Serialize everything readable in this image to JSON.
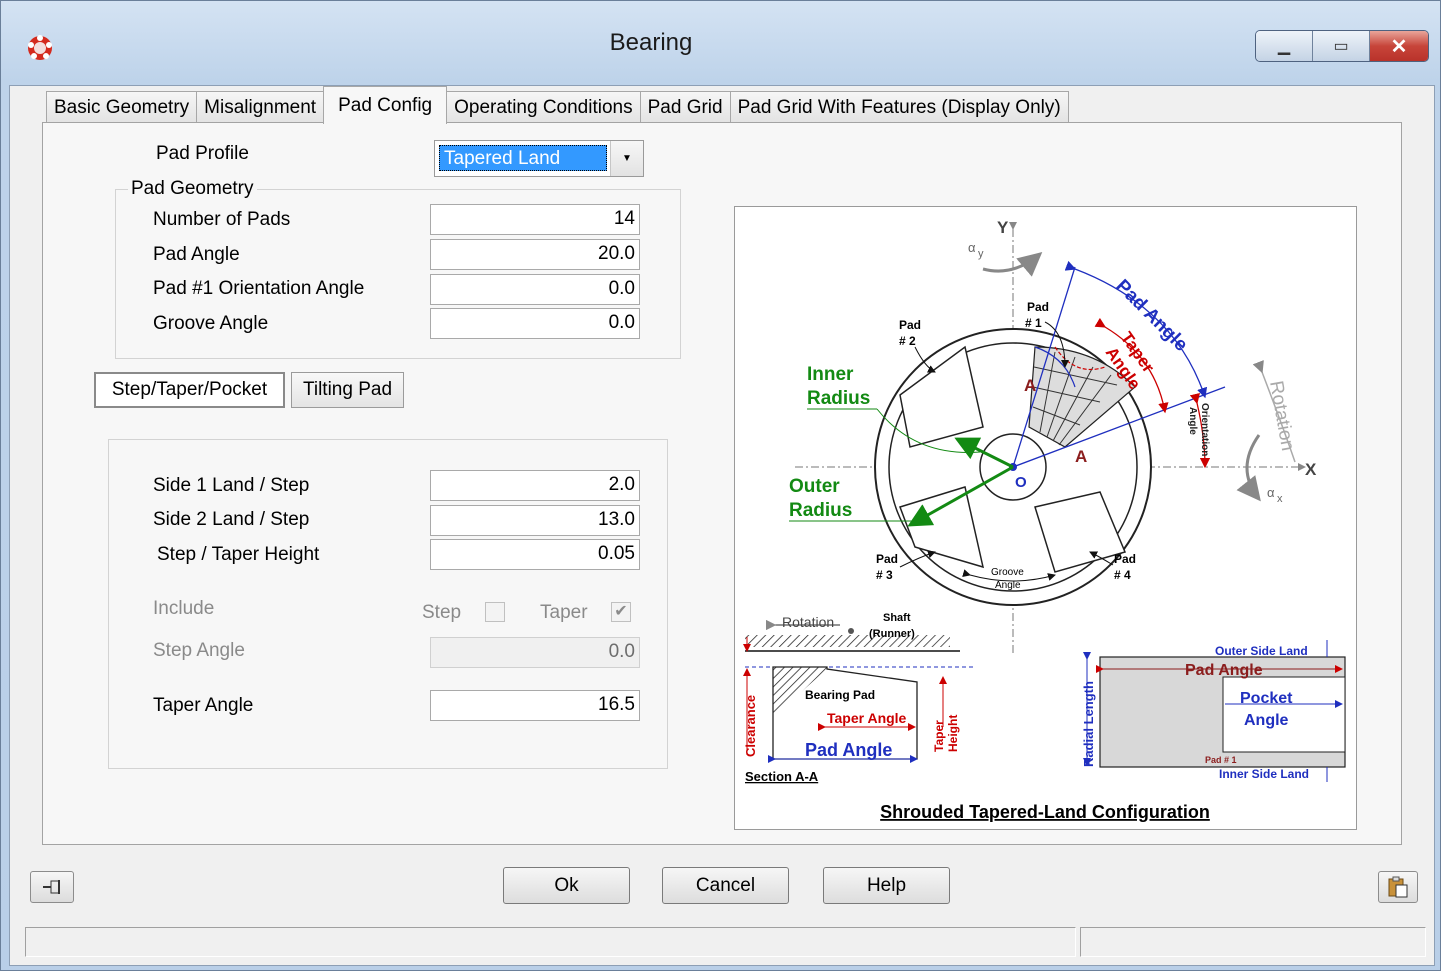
{
  "window": {
    "title": "Bearing",
    "app_icon": "bearing-app-icon",
    "controls": [
      "minimize",
      "maximize",
      "close"
    ]
  },
  "tabs": [
    {
      "label": "Basic Geometry",
      "active": false
    },
    {
      "label": "Misalignment",
      "active": false
    },
    {
      "label": "Pad Config",
      "active": true
    },
    {
      "label": "Operating Conditions",
      "active": false
    },
    {
      "label": "Pad Grid",
      "active": false
    },
    {
      "label": "Pad Grid With Features (Display Only)",
      "active": false
    }
  ],
  "pad_profile": {
    "label": "Pad Profile",
    "value": "Tapered Land"
  },
  "pad_geometry": {
    "title": "Pad Geometry",
    "number_of_pads": {
      "label": "Number of Pads",
      "value": "14"
    },
    "pad_angle": {
      "label": "Pad Angle",
      "value": "20.0"
    },
    "orientation_angle": {
      "label": "Pad #1 Orientation Angle",
      "value": "0.0"
    },
    "groove_angle": {
      "label": "Groove Angle",
      "value": "0.0"
    }
  },
  "subtabs": [
    {
      "label": "Step/Taper/Pocket",
      "active": true
    },
    {
      "label": "Tilting Pad",
      "active": false
    }
  ],
  "step_taper": {
    "side1": {
      "label": "Side 1 Land / Step",
      "value": "2.0"
    },
    "side2": {
      "label": "Side 2 Land / Step",
      "value": "13.0"
    },
    "height": {
      "label": "Step / Taper Height",
      "value": "0.05"
    },
    "include": {
      "label": "Include",
      "step_label": "Step",
      "step_checked": false,
      "taper_label": "Taper",
      "taper_checked": true
    },
    "step_angle": {
      "label": "Step Angle",
      "value": "0.0"
    },
    "taper_angle": {
      "label": "Taper Angle",
      "value": "16.5"
    }
  },
  "diagram": {
    "y_axis": "Y",
    "x_axis": "X",
    "alpha_y": "α",
    "alpha_y_sub": "y",
    "alpha_x": "α",
    "alpha_x_sub": "x",
    "pad1": [
      "Pad",
      "# 1"
    ],
    "pad2": [
      "Pad",
      "# 2"
    ],
    "pad3": [
      "Pad",
      "# 3"
    ],
    "pad4": [
      "Pad",
      "# 4"
    ],
    "inner_radius": [
      "Inner",
      "Radius"
    ],
    "outer_radius": [
      "Outer",
      "Radius"
    ],
    "pad_angle": "Pad Angle",
    "taper_angle": [
      "Taper",
      "Angle"
    ],
    "orientation_angle": [
      "Orientation",
      "Angle"
    ],
    "rotation": "Rotation",
    "groove_angle": [
      "Groove",
      "Angle"
    ],
    "origin": "O",
    "section_mark": "A",
    "section_rotation": "Rotation",
    "shaft": [
      "Shaft",
      "(Runner)"
    ],
    "bearing_pad": "Bearing Pad",
    "section_taper_angle": "Taper Angle",
    "section_pad_angle": "Pad Angle",
    "clearance": "Clearance",
    "taper_height": [
      "Taper",
      "Height"
    ],
    "section_label": "Section A-A",
    "outer_side_land": "Outer Side Land",
    "inner_side_land": "Inner Side Land",
    "radial_length": "Radial Length",
    "pocket_pad_angle": "Pad Angle",
    "pocket_angle": [
      "Pocket",
      "Angle"
    ],
    "pocket_pad1": "Pad # 1",
    "caption": "Shrouded Tapered-Land Configuration"
  },
  "buttons": {
    "ok": "Ok",
    "cancel": "Cancel",
    "help": "Help"
  },
  "status": {
    "left": "",
    "right": ""
  }
}
